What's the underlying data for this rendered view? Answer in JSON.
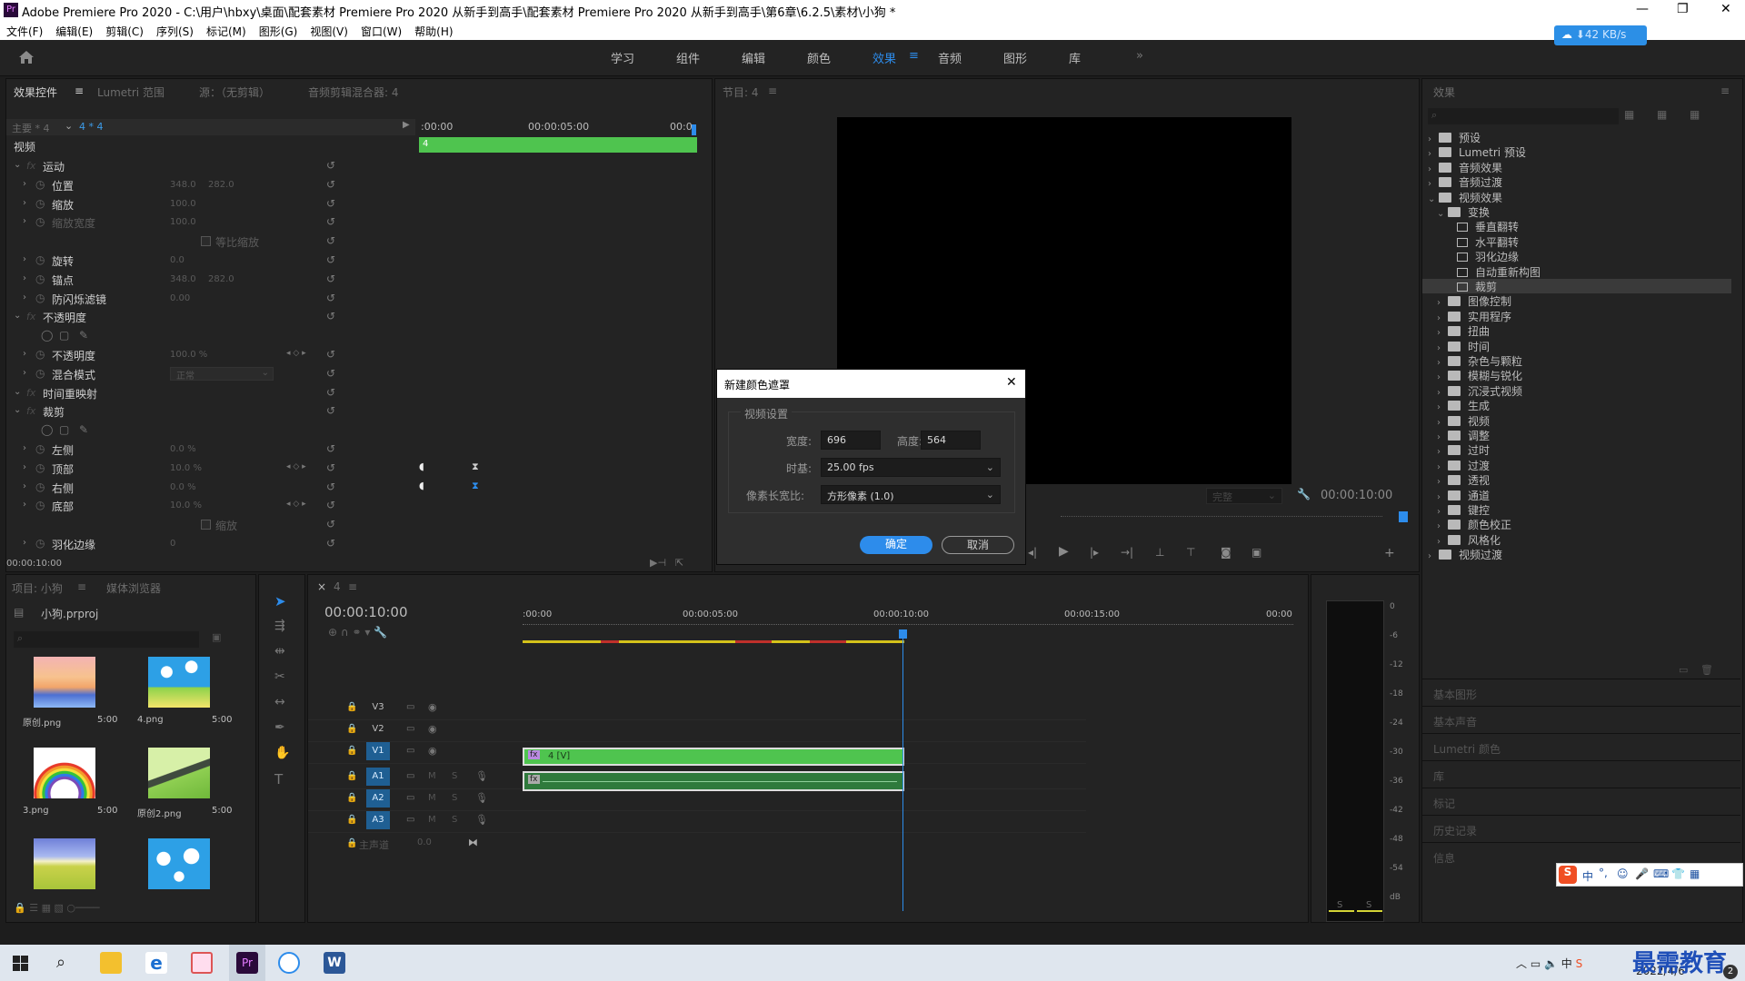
{
  "titlebar": {
    "title": "Adobe Premiere Pro 2020 - C:\\用户\\hbxy\\桌面\\配套素材 Premiere Pro 2020 从新手到高手\\配套素材 Premiere Pro 2020 从新手到高手\\第6章\\6.2.5\\素材\\小狗 *",
    "logo": "Pr",
    "minimize": "—",
    "maximize": "❐",
    "close": "✕"
  },
  "menu": [
    "文件(F)",
    "编辑(E)",
    "剪辑(C)",
    "序列(S)",
    "标记(M)",
    "图形(G)",
    "视图(V)",
    "窗口(W)",
    "帮助(H)"
  ],
  "workspaces": [
    "学习",
    "组件",
    "编辑",
    "颜色",
    "效果",
    "音频",
    "图形",
    "库"
  ],
  "workspaces_more": "»",
  "network": {
    "speed": "⬇42 KB/s"
  },
  "effect_controls": {
    "tabs": [
      "效果控件",
      "Lumetri 范围",
      "源：（无剪辑）",
      "音频剪辑混合器: 4"
    ],
    "master_label": "主要 * 4",
    "clip_label": "4 * 4",
    "video_label": "视频",
    "timecode_left": ":00:00",
    "timecode_mid": "00:00:05:00",
    "timecode_right": "00:0",
    "clip_name": "4",
    "rows": [
      {
        "indent": 0,
        "fx": true,
        "label": "运动",
        "v1": "",
        "v2": ""
      },
      {
        "indent": 1,
        "label": "位置",
        "v1": "348.0",
        "v2": "282.0"
      },
      {
        "indent": 1,
        "label": "缩放",
        "v1": "100.0",
        "v2": ""
      },
      {
        "indent": 1,
        "label": "缩放宽度",
        "v1": "100.0",
        "v2": "",
        "dim": true
      },
      {
        "indent": 2,
        "label": "等比缩放",
        "v1": "",
        "v2": "",
        "check": true,
        "dim": true
      },
      {
        "indent": 1,
        "label": "旋转",
        "v1": "0.0",
        "v2": ""
      },
      {
        "indent": 1,
        "label": "锚点",
        "v1": "348.0",
        "v2": "282.0"
      },
      {
        "indent": 1,
        "label": "防闪烁滤镜",
        "v1": "0.00",
        "v2": ""
      },
      {
        "indent": 0,
        "fx": true,
        "label": "不透明度",
        "v1": "",
        "v2": ""
      },
      {
        "indent": 2,
        "label": "",
        "v1": "",
        "v2": "",
        "shapes": true
      },
      {
        "indent": 1,
        "label": "不透明度",
        "v1": "100.0 %",
        "v2": "",
        "kf": true
      },
      {
        "indent": 1,
        "label": "混合模式",
        "v1": "正常",
        "v2": "",
        "select": true
      },
      {
        "indent": 0,
        "fx": true,
        "label": "时间重映射",
        "v1": "",
        "v2": ""
      },
      {
        "indent": 0,
        "fx": true,
        "label": "裁剪",
        "v1": "",
        "v2": ""
      },
      {
        "indent": 2,
        "label": "",
        "v1": "",
        "v2": "",
        "shapes": true
      },
      {
        "indent": 1,
        "label": "左侧",
        "v1": "0.0 %",
        "v2": ""
      },
      {
        "indent": 1,
        "label": "顶部",
        "v1": "10.0 %",
        "v2": "",
        "kf": true
      },
      {
        "indent": 1,
        "label": "右侧",
        "v1": "0.0 %",
        "v2": ""
      },
      {
        "indent": 1,
        "label": "底部",
        "v1": "10.0 %",
        "v2": "",
        "kf": true
      },
      {
        "indent": 2,
        "label": "缩放",
        "v1": "",
        "v2": "",
        "check": true,
        "dim": true
      },
      {
        "indent": 1,
        "label": "羽化边缘",
        "v1": "0",
        "v2": ""
      }
    ],
    "footer_time": "00:00:10:00"
  },
  "program": {
    "tab": "节目: 4",
    "fit": "完整",
    "timecode": "00:00:10:00"
  },
  "dialog": {
    "title": "新建颜色遮罩",
    "section": "视频设置",
    "width_label": "宽度:",
    "width_value": "696",
    "height_label": "高度:",
    "height_value": "564",
    "timebase_label": "时基:",
    "timebase_value": "25.00 fps",
    "par_label": "像素长宽比:",
    "par_value": "方形像素 (1.0)",
    "ok": "确定",
    "cancel": "取消",
    "close": "✕"
  },
  "effects_panel": {
    "title": "效果",
    "tree": [
      {
        "level": 0,
        "kind": "folder",
        "label": "预设",
        "open": false
      },
      {
        "level": 0,
        "kind": "folder",
        "label": "Lumetri 预设",
        "open": false
      },
      {
        "level": 0,
        "kind": "folder",
        "label": "音频效果",
        "open": false
      },
      {
        "level": 0,
        "kind": "folder",
        "label": "音频过渡",
        "open": false
      },
      {
        "level": 0,
        "kind": "folder",
        "label": "视频效果",
        "open": true
      },
      {
        "level": 1,
        "kind": "folder",
        "label": "变换",
        "open": true
      },
      {
        "level": 2,
        "kind": "fx",
        "label": "垂直翻转"
      },
      {
        "level": 2,
        "kind": "fx",
        "label": "水平翻转"
      },
      {
        "level": 2,
        "kind": "fx",
        "label": "羽化边缘"
      },
      {
        "level": 2,
        "kind": "fx",
        "label": "自动重新构图"
      },
      {
        "level": 2,
        "kind": "fx",
        "label": "裁剪",
        "selected": true
      },
      {
        "level": 1,
        "kind": "folder",
        "label": "图像控制",
        "open": false
      },
      {
        "level": 1,
        "kind": "folder",
        "label": "实用程序",
        "open": false
      },
      {
        "level": 1,
        "kind": "folder",
        "label": "扭曲",
        "open": false
      },
      {
        "level": 1,
        "kind": "folder",
        "label": "时间",
        "open": false
      },
      {
        "level": 1,
        "kind": "folder",
        "label": "杂色与颗粒",
        "open": false
      },
      {
        "level": 1,
        "kind": "folder",
        "label": "模糊与锐化",
        "open": false
      },
      {
        "level": 1,
        "kind": "folder",
        "label": "沉浸式视频",
        "open": false
      },
      {
        "level": 1,
        "kind": "folder",
        "label": "生成",
        "open": false
      },
      {
        "level": 1,
        "kind": "folder",
        "label": "视频",
        "open": false
      },
      {
        "level": 1,
        "kind": "folder",
        "label": "调整",
        "open": false
      },
      {
        "level": 1,
        "kind": "folder",
        "label": "过时",
        "open": false
      },
      {
        "level": 1,
        "kind": "folder",
        "label": "过渡",
        "open": false
      },
      {
        "level": 1,
        "kind": "folder",
        "label": "透视",
        "open": false
      },
      {
        "level": 1,
        "kind": "folder",
        "label": "通道",
        "open": false
      },
      {
        "level": 1,
        "kind": "folder",
        "label": "键控",
        "open": false
      },
      {
        "level": 1,
        "kind": "folder",
        "label": "颜色校正",
        "open": false
      },
      {
        "level": 1,
        "kind": "folder",
        "label": "风格化",
        "open": false
      },
      {
        "level": 0,
        "kind": "folder",
        "label": "视频过渡",
        "open": false
      }
    ],
    "collapsed_panels": [
      "基本图形",
      "基本声音",
      "Lumetri 颜色",
      "库",
      "标记",
      "历史记录",
      "信息"
    ]
  },
  "project": {
    "tabs": [
      "项目: 小狗",
      "媒体浏览器"
    ],
    "file": "小狗.prproj",
    "items": [
      {
        "name": "原创.png",
        "duration": "5:00",
        "thumb": "sunset"
      },
      {
        "name": "4.png",
        "duration": "5:00",
        "thumb": "flowers"
      },
      {
        "name": "3.png",
        "duration": "5:00",
        "thumb": "rainbow"
      },
      {
        "name": "原创2.png",
        "duration": "5:00",
        "thumb": "road"
      },
      {
        "name": "",
        "duration": "",
        "thumb": "field"
      },
      {
        "name": "",
        "duration": "",
        "thumb": "clouds"
      }
    ]
  },
  "timeline": {
    "tab": "4",
    "timecode": "00:00:10:00",
    "ruler": [
      ":00:00",
      "00:00:05:00",
      "00:00:10:00",
      "00:00:15:00",
      "00:00"
    ],
    "tracks_video": [
      "V3",
      "V2",
      "V1"
    ],
    "tracks_audio": [
      "A1",
      "A2",
      "A3"
    ],
    "master_label": "主声道",
    "master_value": "0.0",
    "video_clip": "4 [V]",
    "playhead_seconds": 10
  },
  "meter": {
    "scale": [
      "0",
      "-6",
      "-12",
      "-18",
      "-24",
      "-30",
      "-36",
      "-42",
      "-48",
      "-54",
      "dB"
    ],
    "solo": [
      "S",
      "S"
    ]
  },
  "ime": {
    "items": [
      "中",
      "°,"
    ]
  },
  "taskbar": {
    "date": "2022/4/6",
    "watermark": "最需教育",
    "badge": "2"
  }
}
